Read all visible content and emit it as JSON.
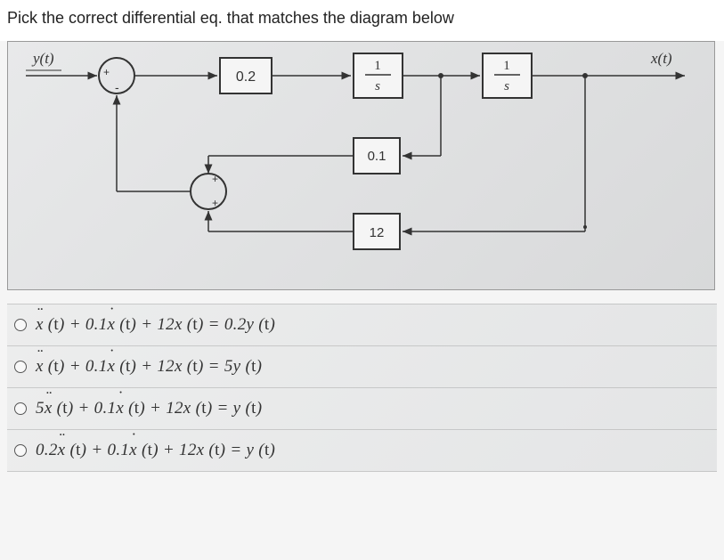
{
  "prompt": "Pick the correct differential eq. that matches the diagram below",
  "diagram": {
    "input_label": "y(t)",
    "output_label": "x(t)",
    "gain_main": "0.2",
    "integrator1": {
      "num": "1",
      "den": "s"
    },
    "integrator2": {
      "num": "1",
      "den": "s"
    },
    "feedback_gain1": "0.1",
    "feedback_gain2": "12",
    "sum1": {
      "top": "+",
      "bottom": "-"
    },
    "sum2": {
      "top": "+",
      "bottom": "+"
    }
  },
  "options": [
    {
      "text": "ẍ (t) + 0.1ẋ (t) + 12x (t) = 0.2y (t)"
    },
    {
      "text": "ẍ (t) + 0.1ẋ (t) + 12x (t) = 5y (t)"
    },
    {
      "text": "5ẍ (t) + 0.1ẋ (t) + 12x (t) = y (t)"
    },
    {
      "text": "0.2ẍ (t) + 0.1ẋ (t) + 12x (t) = y (t)"
    }
  ]
}
